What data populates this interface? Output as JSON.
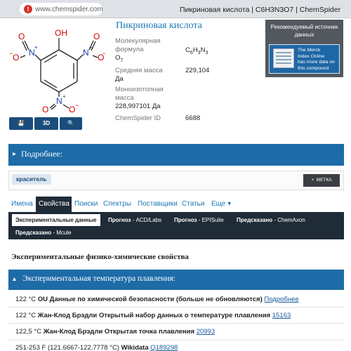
{
  "browser": {
    "url": "www.chemspider.com",
    "tab_title": "Пикриновая кислота | C6H3N3O7 | ChemSpider"
  },
  "structure": {
    "atoms": {
      "oh": "OH",
      "n_left": "N",
      "n_right": "N",
      "n_bottom": "N",
      "o": "O",
      "o_minus": "O",
      "plus": "+",
      "minus": "−"
    },
    "buttons": {
      "save_label": "💾",
      "three_d_label": "3D",
      "zoom_label": "🔍"
    }
  },
  "compound": {
    "title": "Пикриновая кислота",
    "formula_label_line1": "Молекулярная",
    "formula_label_line2": "формула",
    "formula_value": "C6H3N3",
    "formula_value_line2": "O7",
    "avg_mass_label_line1": "Средняя масса",
    "avg_mass_label_line2": "Да",
    "avg_mass_value": "229,104",
    "mono_mass_label_line1": "Моноизотопная",
    "mono_mass_label_line2": "масса",
    "mono_mass_value": "228,997101 Да",
    "csid_label": "ChemSpider ID",
    "csid_value": "6688"
  },
  "recommended_source": {
    "title": "Рекомендуемый источник данных",
    "banner_line1": "The Merck",
    "banner_line2_a": "Index ",
    "banner_line2_b": "Online",
    "banner_line3": "has more data on",
    "banner_line4": "this compound"
  },
  "more_section": {
    "title": "Подробнее:",
    "tag": "краситель",
    "tag_button": "МЕТКА"
  },
  "tabs": [
    "Имена",
    "Свойства",
    "Поиски",
    "Спектры",
    "Поставщики",
    "Статьи",
    "Еще ▾"
  ],
  "active_tab": "Свойства",
  "subtabs": {
    "experimental": "Экспериментальные данные",
    "acd_bold": "Прогноз",
    "acd_rest": " - ACD/Labs",
    "epi_bold": "Прогноз",
    "epi_rest": " - EPISuite",
    "chemaxon_bold": "Предсказано",
    "chemaxon_rest": " - ChemAxon",
    "mcule_bold": "Предсказано",
    "mcule_rest": " - Mcule"
  },
  "experimental": {
    "heading": "Экспериментальные физико-химические свойства",
    "melting_point_title": "Экспериментальная температура плавления:",
    "rows": [
      {
        "value": "122 °C ",
        "source": "OU Данные по химической безопасности (больше не обновляются) ",
        "link": "Подробнее"
      },
      {
        "value": "122 °C ",
        "source": "Жан-Клод Брэдли Открытый набор данных о температуре плавления ",
        "link": "15163"
      },
      {
        "value": "122,5 °C ",
        "source": "Жан-Клод Брэдли Открытая точка плавления ",
        "link": "20993"
      },
      {
        "value": "251-253 F (121.6667-122.7778 °C) ",
        "source": "Wikidata ",
        "link": "Q189298"
      }
    ]
  }
}
